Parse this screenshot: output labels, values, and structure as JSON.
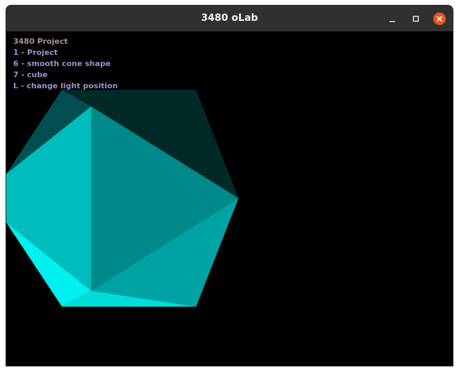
{
  "window": {
    "title": "3480 oLab",
    "controls": {
      "minimize_icon": "minimize-icon",
      "maximize_icon": "maximize-icon",
      "close_icon": "close-icon",
      "close_color": "#e95420"
    }
  },
  "hud": {
    "title": "3480 Project",
    "items": [
      "1 - Project",
      "6 - smooth cone shape",
      "7 - cube",
      "L - change light position"
    ],
    "title_color": "#a4988a",
    "item_color": "#9c91c8"
  },
  "scene": {
    "background": "#000000",
    "object": "icosahedron",
    "face_colors": [
      "#022828",
      "#024d4f",
      "#00bdbd",
      "#00898a",
      "#00a3a3",
      "#00f0f0",
      "#00dcdc"
    ]
  }
}
